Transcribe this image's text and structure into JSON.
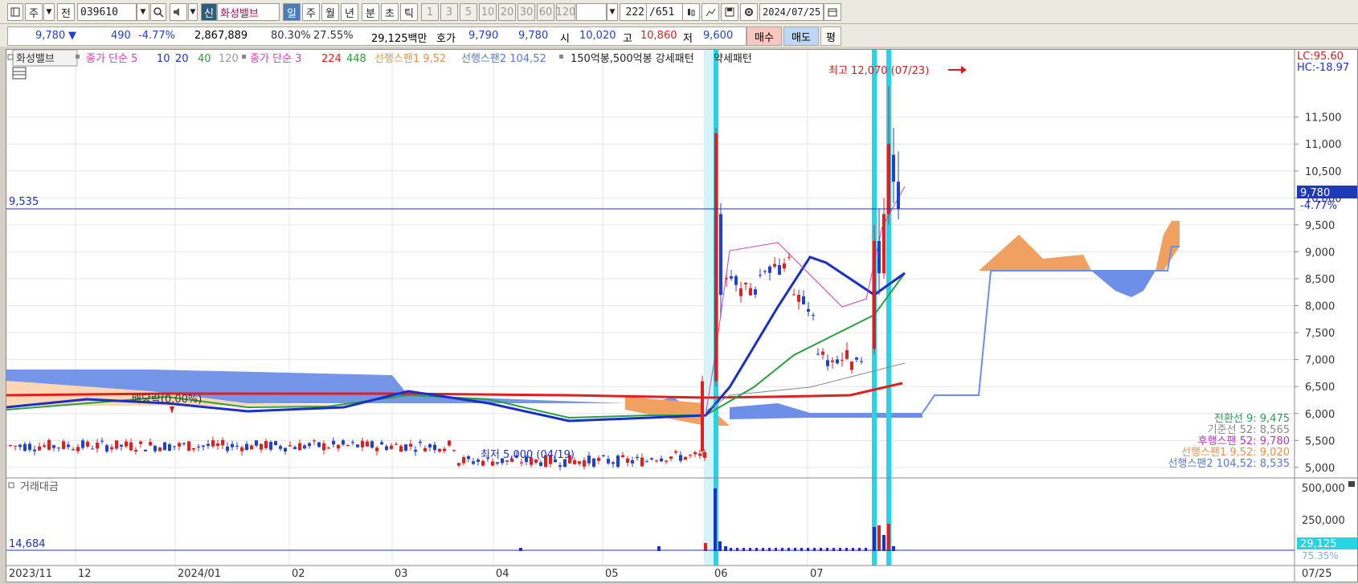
{
  "toolbar": {
    "code": "039610",
    "stock_name": "화성밸브",
    "new_badge": "신",
    "jeon": "전",
    "ju": "주",
    "periods": [
      "일",
      "주",
      "월",
      "년",
      "분",
      "초",
      "틱"
    ],
    "intervals": [
      "1",
      "3",
      "5",
      "10",
      "20",
      "30",
      "60",
      "120"
    ],
    "page_current": "222",
    "page_total": "/651",
    "date": "2024/07/25"
  },
  "info": {
    "price": "9,780",
    "arrow": "▼",
    "change": "490",
    "change_pct": "-4.77%",
    "volume": "2,867,889",
    "ratio1": "80.30%",
    "ratio2": "27.55%",
    "amount": "29,125백만",
    "hoga_label": "호가",
    "hoga1": "9,790",
    "hoga2": "9,780",
    "open_label": "시",
    "open": "10,020",
    "high_label": "고",
    "high": "10,860",
    "low_label": "저",
    "low": "9,600",
    "buy": "매수",
    "sell": "매도",
    "eval": "평"
  },
  "legend": {
    "stock_name": "화성밸브",
    "ma_label": "종가 단순 5",
    "ma10": "10",
    "ma20": "20",
    "ma40": "40",
    "ma120": "120",
    "ma2_label": "종가 단순 3",
    "ma224": "224",
    "ma448": "448",
    "span1": "선행스팬1 9,52",
    "span2": "선행스팬2 104,52",
    "pattern": "150억봉,500억봉 강세패턴",
    "weak": "약세패턴"
  },
  "annotations": {
    "high_note": "최고 12,070 (07/23)",
    "low_note": "최저 5,000 (04/19)",
    "dividend": "배당락(0.00%)",
    "hline_value": "9,535",
    "lc": "LC:95.60",
    "hc": "HC:-18.97",
    "last_price": "9,780",
    "last_pct": "-4.77%",
    "ichimoku_lines": [
      {
        "text": "전환선 9: 9,475",
        "color": "#2a9a5a"
      },
      {
        "text": "기준선 52: 8,565",
        "color": "#888888"
      },
      {
        "text": "후행스팬 52: 9,780",
        "color": "#b040b0"
      },
      {
        "text": "선행스팬1 9,52: 9,020",
        "color": "#e89050"
      },
      {
        "text": "선행스팬2 104,52: 8,535",
        "color": "#5a7ad0"
      }
    ]
  },
  "volume_panel": {
    "title": "거래대금",
    "ref_value": "14,684",
    "last_value": "29,125",
    "last_pct": "75.35%",
    "ticks": [
      "500,000",
      "250,000"
    ]
  },
  "x_axis": {
    "labels": [
      "2023/11",
      "12",
      "2024/01",
      "02",
      "03",
      "04",
      "05",
      "06",
      "07"
    ],
    "end_label": "07/25"
  },
  "colors": {
    "up": "#e02020",
    "down": "#2040d0",
    "cloud_orange": "#f0a060",
    "cloud_blue": "#6e8fe8",
    "highlight": "#27d4e4"
  },
  "chart_data": {
    "type": "candlestick",
    "y_ticks": [
      5000,
      5500,
      6000,
      6500,
      7000,
      7500,
      8000,
      8500,
      9000,
      9500,
      10000,
      10500,
      11000,
      11500
    ],
    "ylim": [
      4700,
      12300
    ],
    "high": 12070,
    "low": 5000,
    "last_close": 9780,
    "reference_line": 9535
  }
}
